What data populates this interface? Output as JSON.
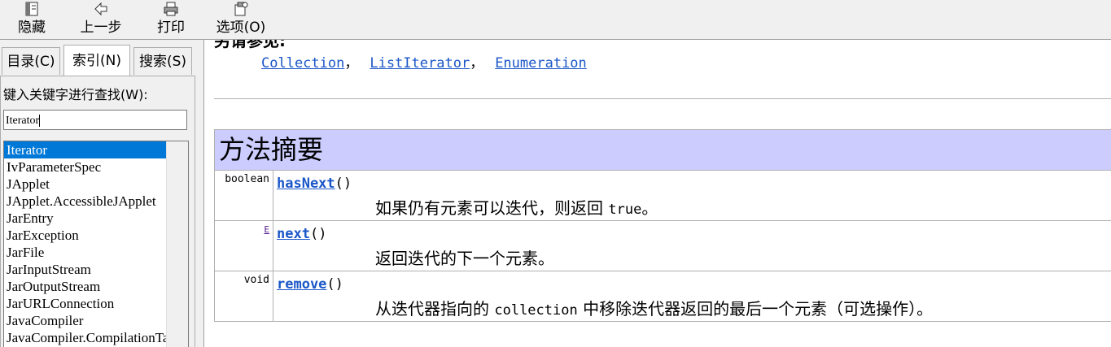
{
  "toolbar": {
    "hide_label": "隐藏",
    "back_label": "上一步",
    "print_label": "打印",
    "options_label": "选项(O)"
  },
  "nav": {
    "tabs": [
      {
        "label": "目录(C)"
      },
      {
        "label": "索引(N)"
      },
      {
        "label": "搜索(S)"
      }
    ],
    "active_tab": "索引(N)",
    "keyword_label": "键入关键字进行查找(W):",
    "keyword_value": "Iterator",
    "items": [
      "Iterator",
      "IvParameterSpec",
      "JApplet",
      "JApplet.AccessibleJApplet",
      "JarEntry",
      "JarException",
      "JarFile",
      "JarInputStream",
      "JarOutputStream",
      "JarURLConnection",
      "JavaCompiler",
      "JavaCompiler.CompilationTask"
    ],
    "selected_item": "Iterator"
  },
  "content": {
    "see_also_heading": "另请参见:",
    "see_also_links": [
      "Collection",
      "ListIterator",
      "Enumeration"
    ],
    "see_also_sep": "，",
    "summary_title": "方法摘要",
    "methods": [
      {
        "type": "boolean",
        "name": "hasNext",
        "params": "()",
        "desc_before": "如果仍有元素可以迭代，则返回 ",
        "desc_code": "true",
        "desc_after": "。"
      },
      {
        "type": "E",
        "name": "next",
        "params": "()",
        "desc_before": "返回迭代的下一个元素。",
        "desc_code": "",
        "desc_after": ""
      },
      {
        "type": "void",
        "name": "remove",
        "params": "()",
        "desc_before": "从迭代器指向的 ",
        "desc_code": "collection",
        "desc_after": " 中移除迭代器返回的最后一个元素（可选操作）。"
      }
    ]
  },
  "colors": {
    "accent_selection": "#0078d7",
    "summary_header_bg": "#ccccff",
    "link": "#1a56c8"
  }
}
